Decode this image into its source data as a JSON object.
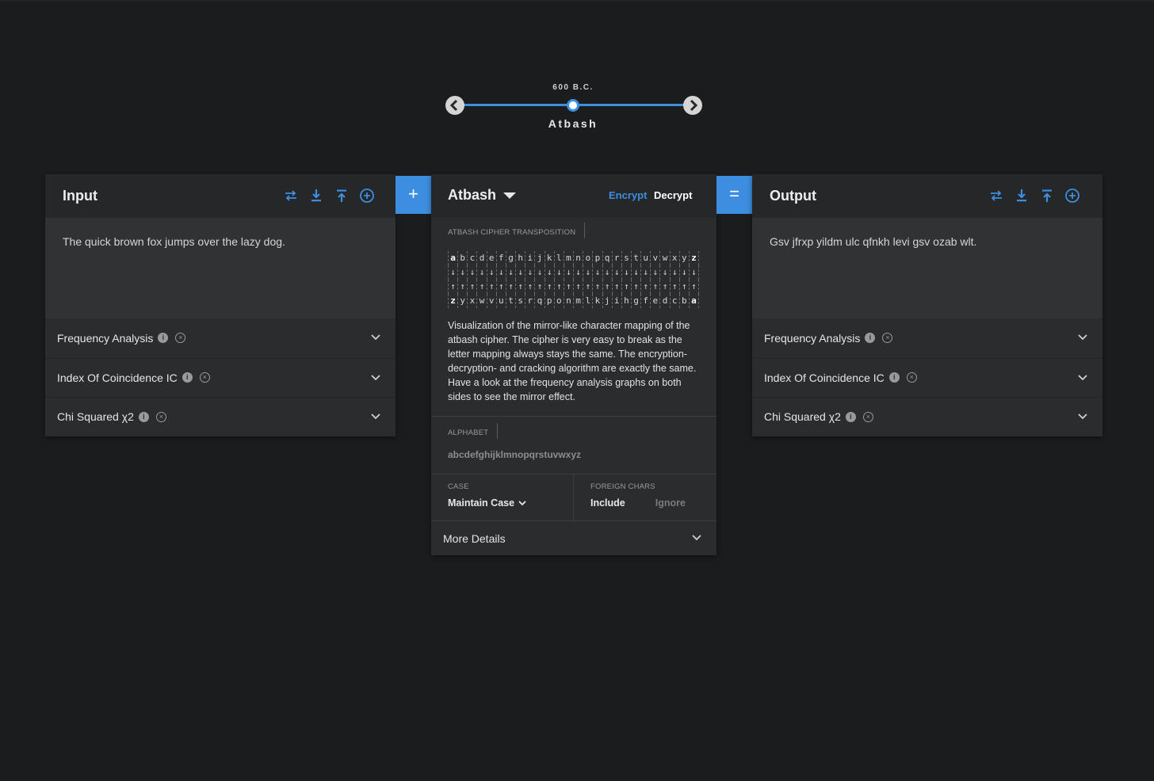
{
  "timeline": {
    "date": "600 B.C.",
    "cipher_name": "Atbash"
  },
  "input_panel": {
    "title": "Input",
    "text": "The quick brown fox jumps over the lazy dog.",
    "icons": [
      "swap-icon",
      "download-icon",
      "upload-icon",
      "add-circle-icon"
    ]
  },
  "output_panel": {
    "title": "Output",
    "text": "Gsv jfrxp yildm ulc qfnkh levi gsv ozab wlt.",
    "icons": [
      "swap-icon",
      "download-icon",
      "upload-icon",
      "add-circle-icon"
    ]
  },
  "analysis": {
    "frequency": "Frequency Analysis",
    "ic": "Index Of Coincidence IC",
    "chi": "Chi Squared χ2"
  },
  "connectors": {
    "plus": "+",
    "equals": "="
  },
  "cipher": {
    "name": "Atbash",
    "encrypt": "Encrypt",
    "decrypt": "Decrypt",
    "viz_label": "ATBASH CIPHER TRANSPOSITION",
    "top_row": [
      "a",
      "b",
      "c",
      "d",
      "e",
      "f",
      "g",
      "h",
      "i",
      "j",
      "k",
      "l",
      "m",
      "n",
      "o",
      "p",
      "q",
      "r",
      "s",
      "t",
      "u",
      "v",
      "w",
      "x",
      "y",
      "z"
    ],
    "bottom_row": [
      "z",
      "y",
      "x",
      "w",
      "v",
      "u",
      "t",
      "s",
      "r",
      "q",
      "p",
      "o",
      "n",
      "m",
      "l",
      "k",
      "j",
      "i",
      "h",
      "g",
      "f",
      "e",
      "d",
      "c",
      "b",
      "a"
    ],
    "description": "Visualization of the mirror-like character mapping of the atbash cipher. The cipher is very easy to break as the letter mapping always stays the same. The encryption- decryption- and cracking algorithm are exactly the same. Have a look at the frequency analysis graphs on both sides to see the mirror effect.",
    "alphabet_label": "ALPHABET",
    "alphabet_value": "abcdefghijklmnopqrstuvwxyz",
    "case_label": "CASE",
    "case_value": "Maintain Case",
    "foreign_label": "FOREIGN CHARS",
    "foreign_include": "Include",
    "foreign_ignore": "Ignore",
    "more_details": "More Details"
  },
  "colors": {
    "accent": "#3d8ee0",
    "background": "#1b1c1e",
    "panel": "#2b2c2e"
  }
}
